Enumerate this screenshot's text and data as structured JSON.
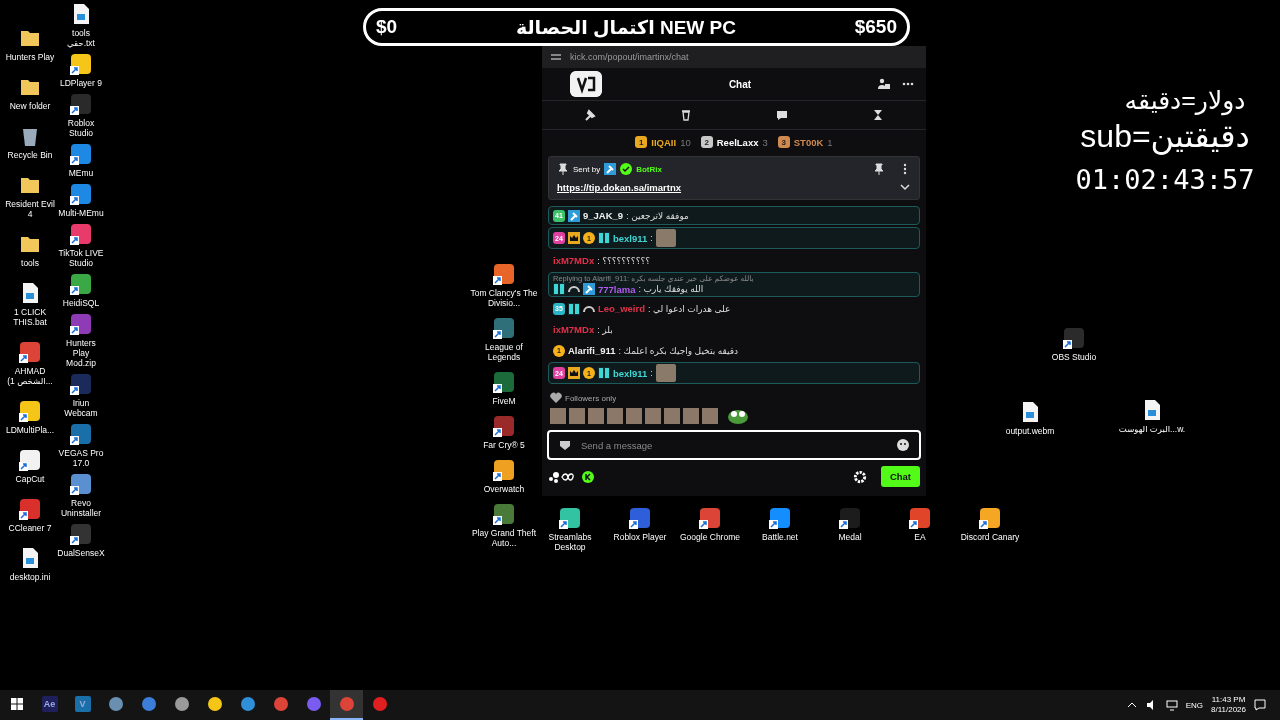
{
  "goal_bar": {
    "level": 0,
    "start": "$0",
    "title": "اكتمال الحصالة NEW PC",
    "end": "$650"
  },
  "desktop_left": [
    {
      "label": "Hunters Play",
      "kind": "folder"
    },
    {
      "label": "New folder",
      "kind": "folder"
    },
    {
      "label": "Recycle Bin",
      "kind": "bin"
    },
    {
      "label": "Resident Evil 4",
      "kind": "folder"
    },
    {
      "label": "tools",
      "kind": "folder"
    },
    {
      "label": "1 CLICK THIS.bat",
      "kind": "file"
    },
    {
      "label": "AHMAD (الشخص 1...",
      "kind": "app",
      "color": "#db4437"
    },
    {
      "label": "LDMultiPla...",
      "kind": "app",
      "color": "#f5c518"
    },
    {
      "label": "CapCut",
      "kind": "app",
      "color": "#f2f2f2"
    },
    {
      "label": "CCleaner 7",
      "kind": "app",
      "color": "#d9302c"
    },
    {
      "label": "desktop.ini",
      "kind": "file"
    }
  ],
  "desktop_second": [
    {
      "label": "tools حقي.txt",
      "kind": "file"
    },
    {
      "label": "LDPlayer 9",
      "kind": "app",
      "color": "#f5c518"
    },
    {
      "label": "Roblox Studio",
      "kind": "app",
      "color": "#2a2a2a"
    },
    {
      "label": "MEmu",
      "kind": "app",
      "color": "#1e88e5"
    },
    {
      "label": "Multi-MEmu",
      "kind": "app",
      "color": "#1e88e5"
    },
    {
      "label": "TikTok LIVE Studio",
      "kind": "app",
      "color": "#e83a6b"
    },
    {
      "label": "HeidiSQL",
      "kind": "app",
      "color": "#3aa845"
    },
    {
      "label": "Hunters Play Mod.zip",
      "kind": "app",
      "color": "#8e3bb5"
    },
    {
      "label": "Iriun Webcam",
      "kind": "app",
      "color": "#1a2a5a"
    },
    {
      "label": "VEGAS Pro 17.0",
      "kind": "app",
      "color": "#1a6fa8"
    },
    {
      "label": "Revo Uninstaller",
      "kind": "app",
      "color": "#5a8fd0"
    },
    {
      "label": "DualSenseX",
      "kind": "app",
      "color": "#333333"
    }
  ],
  "desktop_middle": [
    {
      "label": "Tom Clancy's The Divisio...",
      "kind": "app",
      "color": "#e8652a"
    },
    {
      "label": "League of Legends",
      "kind": "app",
      "color": "#2f6f7a"
    },
    {
      "label": "FiveM",
      "kind": "app",
      "color": "#1c6b3a"
    },
    {
      "label": "Far Cry® 5",
      "kind": "app",
      "color": "#9a2a2a"
    },
    {
      "label": "Overwatch",
      "kind": "app",
      "color": "#f0a020"
    },
    {
      "label": "Play Grand Theft Auto...",
      "kind": "app",
      "color": "#4a7a3a"
    }
  ],
  "desktop_bottom": [
    {
      "label": "Streamlabs Desktop",
      "kind": "app",
      "color": "#31c3a2"
    },
    {
      "label": "Roblox Player",
      "kind": "app",
      "color": "#2f5fd8"
    },
    {
      "label": "Google Chrome",
      "kind": "app",
      "color": "#db4437"
    },
    {
      "label": "Battle.net",
      "kind": "app",
      "color": "#148eff"
    },
    {
      "label": "Medal",
      "kind": "app",
      "color": "#1c1c1c"
    },
    {
      "label": "EA",
      "kind": "app",
      "color": "#e0452a"
    },
    {
      "label": "Discord Canary",
      "kind": "app",
      "color": "#f5a623"
    }
  ],
  "desktop_right": [
    {
      "label": "OBS Studio",
      "kind": "app",
      "color": "#2b2b2b"
    },
    {
      "label": "output.webm",
      "kind": "file"
    },
    {
      "label": "البرت الهوست...w.",
      "kind": "file"
    }
  ],
  "overlay": {
    "rate_dollar": "دولار=دقيقه",
    "rate_sub": "sub=دقيقتين",
    "timer": "01:02:43:57"
  },
  "chat_window": {
    "address": "kick.com/popout/imartinx/chat",
    "title": "Chat",
    "leaderboard": [
      {
        "rank": "1",
        "name": "IIQAII",
        "count": "10",
        "color": "#e8a820"
      },
      {
        "rank": "2",
        "name": "ReelLaxx",
        "count": "3",
        "color": "#c8c8c8"
      },
      {
        "rank": "3",
        "name": "ST00K",
        "count": "1",
        "color": "#d08a50"
      }
    ],
    "pinned": {
      "label": "Sent by",
      "author": "BotRix",
      "link": "https://tip.dokan.sa/imartnx"
    },
    "messages": [
      {
        "kind": "text",
        "highlighted": true,
        "user": "9_JAK_9",
        "color": "#f0f0f0",
        "text": ": موفقه لاترجعين",
        "badges": [
          {
            "kind": "sub",
            "text": "41",
            "color": "#3cc36a"
          },
          {
            "kind": "mod"
          }
        ]
      },
      {
        "kind": "emote",
        "highlighted": true,
        "user": "bexl911",
        "color": "#3fd6d6",
        "text": ":",
        "badges": [
          {
            "kind": "sub",
            "text": "24",
            "color": "#e040a0"
          },
          {
            "kind": "crown"
          },
          {
            "kind": "gift",
            "text": "1"
          },
          {
            "kind": "og"
          }
        ]
      },
      {
        "kind": "text",
        "highlighted": false,
        "user": "ixM7MDx",
        "color": "#e0314b",
        "text": ": ؟؟؟؟؟؟؟؟؟؟"
      },
      {
        "kind": "text",
        "highlighted": true,
        "reply_to": "Replying to Alarifi_911: يالله عوضكم على خير عندي جلسه بكره",
        "user": "777lama",
        "color": "#b05cf0",
        "text": ": الله يوفقك يارب",
        "badges": [
          {
            "kind": "og"
          },
          {
            "kind": "arc"
          },
          {
            "kind": "mod"
          }
        ]
      },
      {
        "kind": "text",
        "highlighted": false,
        "user": "Leo_weird",
        "color": "#e0314b",
        "text": ": على هدرات ادعوا لي",
        "badges": [
          {
            "kind": "sub",
            "text": "35",
            "color": "#2bb5c8"
          },
          {
            "kind": "og"
          },
          {
            "kind": "arc"
          }
        ]
      },
      {
        "kind": "text",
        "highlighted": false,
        "user": "ixM7MDx",
        "color": "#e0314b",
        "text": ": بلز"
      },
      {
        "kind": "text",
        "highlighted": false,
        "user": "Alarifi_911",
        "color": "#f0f0f0",
        "text": ": دقيقه بتخيل واجيك بكره اعلمك",
        "badges": [
          {
            "kind": "gift",
            "text": "1"
          }
        ]
      },
      {
        "kind": "emote",
        "highlighted": true,
        "user": "bexl911",
        "color": "#3fd6d6",
        "text": ":",
        "badges": [
          {
            "kind": "sub",
            "text": "24",
            "color": "#e040a0"
          },
          {
            "kind": "crown"
          },
          {
            "kind": "gift",
            "text": "1"
          },
          {
            "kind": "og"
          }
        ]
      }
    ],
    "followers_label": "Followers only",
    "emote_strip": [
      {
        "kind": "photo"
      },
      {
        "kind": "photo"
      },
      {
        "kind": "photo"
      },
      {
        "kind": "photo"
      },
      {
        "kind": "photo"
      },
      {
        "kind": "photo"
      },
      {
        "kind": "photo"
      },
      {
        "kind": "photo"
      },
      {
        "kind": "photo"
      },
      {
        "kind": "frog"
      }
    ],
    "input": {
      "placeholder": "Send a message"
    },
    "send_button": "Chat"
  },
  "taskbar": {
    "apps": [
      {
        "kind": "windows",
        "selected": false
      },
      {
        "kind": "tile",
        "label": "Ae",
        "color": "#1f1f5c",
        "selected": false
      },
      {
        "kind": "tile",
        "label": "V",
        "color": "#1a6fa8",
        "selected": false
      },
      {
        "kind": "app",
        "color": "#6a8fb0",
        "selected": false
      },
      {
        "kind": "app",
        "color": "#3b7dd8",
        "selected": false
      },
      {
        "kind": "app",
        "color": "#9a9a9a",
        "selected": false
      },
      {
        "kind": "app",
        "color": "#f5c518",
        "selected": false
      },
      {
        "kind": "app",
        "color": "#2f8fd8",
        "selected": false
      },
      {
        "kind": "app",
        "color": "#db4437",
        "selected": false
      },
      {
        "kind": "app",
        "color": "#7b5cf0",
        "selected": false
      },
      {
        "kind": "app",
        "color": "#db4437",
        "selected": true
      },
      {
        "kind": "app",
        "color": "#e02020",
        "selected": false
      }
    ],
    "language": "ENG",
    "time": "11:43 PM",
    "date": "8/11/2026"
  }
}
